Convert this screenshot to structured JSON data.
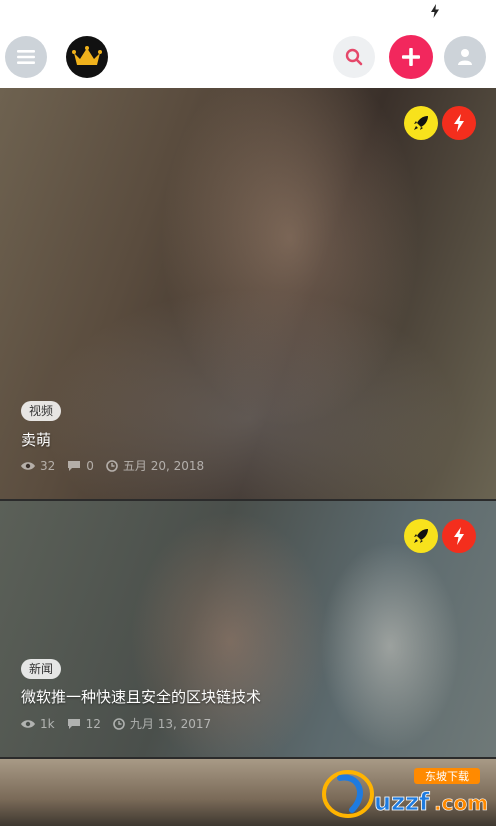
{
  "appbar": {
    "icons": [
      "menu-icon",
      "crown-icon",
      "search-icon",
      "plus-icon",
      "user-icon"
    ],
    "colors": {
      "add": "#f2275d",
      "menu": "#cdd3d9"
    }
  },
  "posts": [
    {
      "tag": "视频",
      "title": "卖萌",
      "views": "32",
      "comments": "0",
      "date": "五月 20, 2018"
    },
    {
      "tag": "新闻",
      "title": "微软推一种快速且安全的区块链技术",
      "views": "1k",
      "comments": "12",
      "date": "九月 13, 2017"
    }
  ],
  "badge_colors": {
    "rocket": "#f8e21c",
    "bolt": "#f42e1d"
  },
  "watermark": {
    "text": "uzzf.com",
    "subtext": "东坡下载"
  }
}
